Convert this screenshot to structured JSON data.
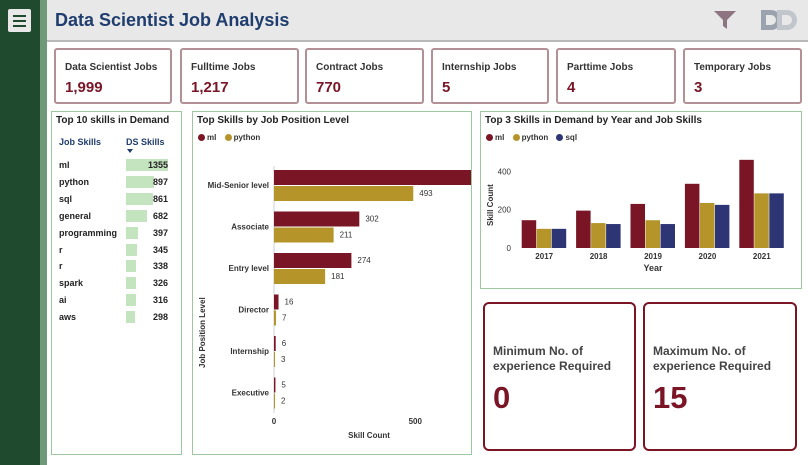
{
  "header": {
    "title": "Data Scientist Job Analysis",
    "menu_icon": "hamburger-menu-icon",
    "filter_icon": "filter-icon",
    "logo": "DD"
  },
  "kpis": [
    {
      "label": "Data Scientist Jobs",
      "value": "1,999"
    },
    {
      "label": "Fulltime Jobs",
      "value": "1,217"
    },
    {
      "label": "Contract Jobs",
      "value": "770"
    },
    {
      "label": "Internship Jobs",
      "value": "5"
    },
    {
      "label": "Parttime Jobs",
      "value": "4"
    },
    {
      "label": "Temporary Jobs",
      "value": "3"
    }
  ],
  "top_skills": {
    "title": "Top 10 skills in Demand",
    "col_skill": "Job Skills",
    "col_count": "DS Skills",
    "max": 1355,
    "rows": [
      {
        "skill": "ml",
        "count": 1355
      },
      {
        "skill": "python",
        "count": 897
      },
      {
        "skill": "sql",
        "count": 861
      },
      {
        "skill": "general",
        "count": 682
      },
      {
        "skill": "programming",
        "count": 397
      },
      {
        "skill": "r",
        "count": 345
      },
      {
        "skill": "r",
        "count": 338
      },
      {
        "skill": "spark",
        "count": 326
      },
      {
        "skill": "ai",
        "count": 316
      },
      {
        "skill": "aws",
        "count": 298
      }
    ]
  },
  "colors": {
    "ml": "#7a1526",
    "python": "#b5952a",
    "sql": "#2d3574",
    "bar_green": "#c4e3bf"
  },
  "chart_data": [
    {
      "type": "bar",
      "orientation": "horizontal",
      "title": "Top Skills by Job Position Level",
      "xlabel": "Skill Count",
      "ylabel": "Job Position Level",
      "categories": [
        "Mid-Senior level",
        "Associate",
        "Entry level",
        "Director",
        "Internship",
        "Executive"
      ],
      "series": [
        {
          "name": "ml",
          "values": [
            752,
            302,
            274,
            16,
            6,
            5
          ]
        },
        {
          "name": "python",
          "values": [
            493,
            211,
            181,
            7,
            3,
            2
          ]
        }
      ],
      "xlim": [
        0,
        800
      ],
      "xticks": [
        0,
        500
      ]
    },
    {
      "type": "bar",
      "title": "Top 3 Skills in Demand by Year and Job Skills",
      "xlabel": "Year",
      "ylabel": "Skill Count",
      "categories": [
        "2017",
        "2018",
        "2019",
        "2020",
        "2021"
      ],
      "series": [
        {
          "name": "ml",
          "values": [
            145,
            195,
            230,
            335,
            460
          ]
        },
        {
          "name": "python",
          "values": [
            100,
            130,
            145,
            235,
            285
          ]
        },
        {
          "name": "sql",
          "values": [
            100,
            125,
            125,
            225,
            285
          ]
        }
      ],
      "ylim": [
        0,
        480
      ],
      "yticks": [
        0,
        200,
        400
      ]
    }
  ],
  "experience": {
    "min_label": "Minimum No. of experience Required",
    "min_value": "0",
    "max_label": "Maximum No. of experience Required",
    "max_value": "15"
  }
}
